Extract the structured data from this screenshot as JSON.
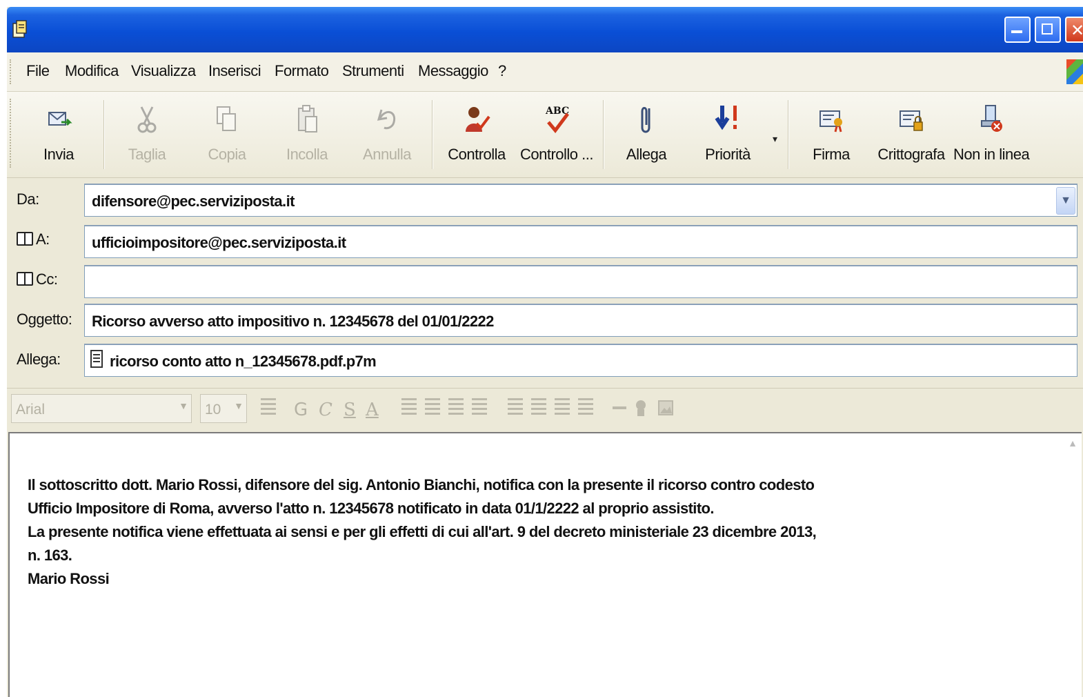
{
  "menu": [
    "File",
    "Modifica",
    "Visualizza",
    "Inserisci",
    "Formato",
    "Strumenti",
    "Messaggio",
    "?"
  ],
  "toolbar": {
    "invia": "Invia",
    "taglia": "Taglia",
    "copia": "Copia",
    "incolla": "Incolla",
    "annulla": "Annulla",
    "controlla": "Controlla",
    "controllo": "Controllo ...",
    "allega": "Allega",
    "priorita": "Priorità",
    "firma": "Firma",
    "crittografa": "Crittografa",
    "non_in_linea": "Non in linea"
  },
  "header": {
    "da_label": "Da:",
    "da_value": "difensore@pec.serviziposta.it",
    "a_label": "A:",
    "a_value": "ufficioimpositore@pec.serviziposta.it",
    "cc_label": "Cc:",
    "cc_value": "",
    "oggetto_label": "Oggetto:",
    "oggetto_value": "Ricorso avverso atto impositivo n. 12345678 del 01/01/2222",
    "allega_label": "Allega:",
    "allega_value": "ricorso conto atto n_12345678.pdf.p7m"
  },
  "format": {
    "font": "Arial",
    "size": "10",
    "bold": "G",
    "italic": "C",
    "underline": "S",
    "color": "A"
  },
  "body": {
    "lines": "Il sottoscritto dott. Mario Rossi, difensore del sig. Antonio Bianchi, notifica con la presente il ricorso contro codesto\nUfficio Impositore di Roma, avverso l'atto n. 12345678 notificato in data 01/1/2222 al proprio assistito.\nLa presente notifica viene effettuata ai sensi e per gli effetti di cui all'art. 9 del decreto ministeriale 23 dicembre 2013,\nn. 163.\nMario Rossi"
  },
  "colors": {
    "titlebar": "#0a4fd6",
    "chrome": "#ece9d8",
    "field_border": "#7f9db9"
  },
  "icons": [
    "app-icon",
    "minimize-icon",
    "maximize-icon",
    "close-icon",
    "send-icon",
    "cut-icon",
    "copy-icon",
    "paste-icon",
    "undo-icon",
    "check-names-icon",
    "spellcheck-icon",
    "paperclip-icon",
    "priority-icon",
    "sign-icon",
    "encrypt-icon",
    "offline-icon",
    "address-book-icon",
    "attachment-file-icon"
  ]
}
